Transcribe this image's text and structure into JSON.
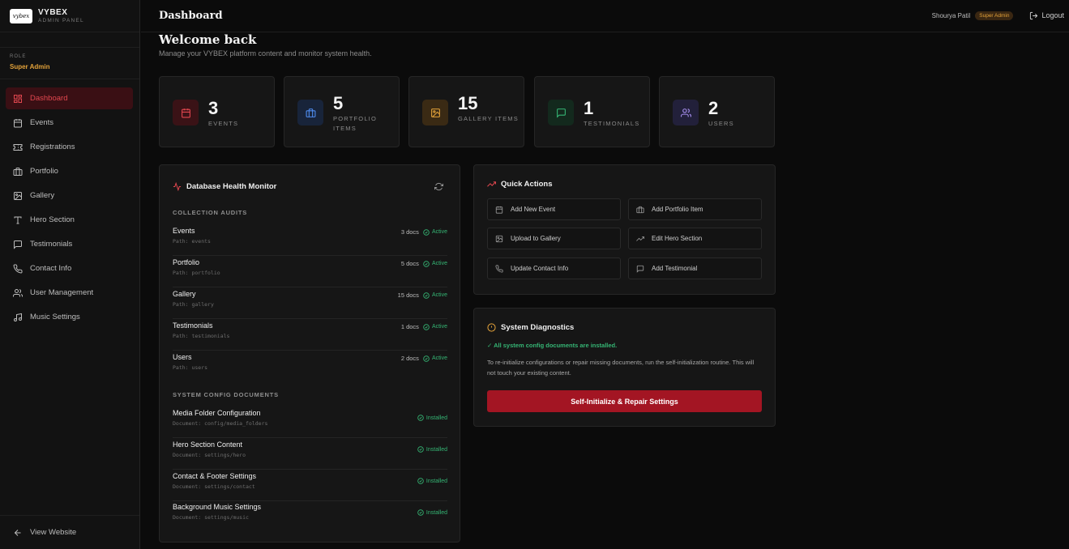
{
  "brand": {
    "logo_text": "vybex",
    "name": "VYBEX",
    "subtitle": "ADMIN PANEL"
  },
  "role": {
    "label": "ROLE",
    "value": "Super Admin"
  },
  "nav": [
    {
      "label": "Dashboard",
      "icon": "dashboard-icon",
      "active": true
    },
    {
      "label": "Events",
      "icon": "calendar-icon"
    },
    {
      "label": "Registrations",
      "icon": "ticket-icon"
    },
    {
      "label": "Portfolio",
      "icon": "briefcase-icon"
    },
    {
      "label": "Gallery",
      "icon": "image-icon"
    },
    {
      "label": "Hero Section",
      "icon": "type-icon"
    },
    {
      "label": "Testimonials",
      "icon": "message-icon"
    },
    {
      "label": "Contact Info",
      "icon": "phone-icon"
    },
    {
      "label": "User Management",
      "icon": "users-icon"
    },
    {
      "label": "Music Settings",
      "icon": "music-icon"
    }
  ],
  "footer": {
    "view_website": "View Website"
  },
  "header": {
    "title": "Dashboard",
    "user_name": "Shourya Patil",
    "user_badge": "Super Admin",
    "logout": "Logout"
  },
  "welcome": {
    "title": "Welcome back",
    "subtitle": "Manage your VYBEX platform content and monitor system health."
  },
  "stats": [
    {
      "value": "3",
      "label": "EVENTS",
      "icon": "calendar-icon",
      "color": "#e2474f",
      "bg": "#3a1216"
    },
    {
      "value": "5",
      "label": "PORTFOLIO ITEMS",
      "icon": "briefcase-icon",
      "color": "#4f8cf0",
      "bg": "#18243a"
    },
    {
      "value": "15",
      "label": "GALLERY ITEMS",
      "icon": "image-icon",
      "color": "#e3a23a",
      "bg": "#3a2a14"
    },
    {
      "value": "1",
      "label": "TESTIMONIALS",
      "icon": "message-icon",
      "color": "#35b574",
      "bg": "#13291d"
    },
    {
      "value": "2",
      "label": "USERS",
      "icon": "users-icon",
      "color": "#a890f0",
      "bg": "#22203a"
    }
  ],
  "db_health": {
    "title": "Database Health Monitor",
    "collections_label": "COLLECTION AUDITS",
    "collections": [
      {
        "name": "Events",
        "path": "Path: events",
        "count": "3 docs",
        "status": "Active"
      },
      {
        "name": "Portfolio",
        "path": "Path: portfolio",
        "count": "5 docs",
        "status": "Active"
      },
      {
        "name": "Gallery",
        "path": "Path: gallery",
        "count": "15 docs",
        "status": "Active"
      },
      {
        "name": "Testimonials",
        "path": "Path: testimonials",
        "count": "1 docs",
        "status": "Active"
      },
      {
        "name": "Users",
        "path": "Path: users",
        "count": "2 docs",
        "status": "Active"
      }
    ],
    "config_label": "SYSTEM CONFIG DOCUMENTS",
    "configs": [
      {
        "name": "Media Folder Configuration",
        "path": "Document: config/media_folders",
        "status": "Installed"
      },
      {
        "name": "Hero Section Content",
        "path": "Document: settings/hero",
        "status": "Installed"
      },
      {
        "name": "Contact & Footer Settings",
        "path": "Document: settings/contact",
        "status": "Installed"
      },
      {
        "name": "Background Music Settings",
        "path": "Document: settings/music",
        "status": "Installed"
      }
    ]
  },
  "quick_actions": {
    "title": "Quick Actions",
    "items": [
      {
        "label": "Add New Event",
        "icon": "calendar-icon"
      },
      {
        "label": "Add Portfolio Item",
        "icon": "briefcase-icon"
      },
      {
        "label": "Upload to Gallery",
        "icon": "image-icon"
      },
      {
        "label": "Edit Hero Section",
        "icon": "trending-icon"
      },
      {
        "label": "Update Contact Info",
        "icon": "phone-icon"
      },
      {
        "label": "Add Testimonial",
        "icon": "message-icon"
      }
    ]
  },
  "diagnostics": {
    "title": "System Diagnostics",
    "status": "✓ All system config documents are installed.",
    "description": "To re-initialize configurations or repair missing documents, run the self-initialization routine. This will not touch your existing content.",
    "button": "Self-Initialize & Repair Settings"
  }
}
